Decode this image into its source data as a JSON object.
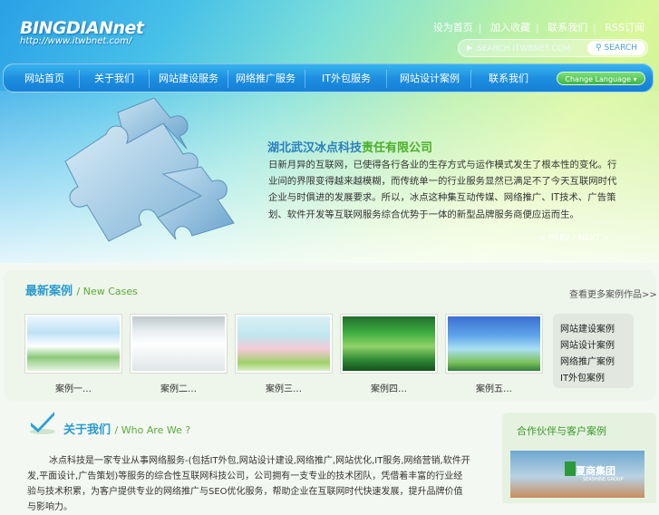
{
  "logo": {
    "brand": "BINGDIANnet",
    "url": "http://www.itwbnet.com/"
  },
  "toplinks": [
    "设为首页",
    "加入收藏",
    "联系我们",
    "RSS订阅"
  ],
  "search": {
    "placeholder": "SEARCH ITWBNET.COM",
    "button": "SEARCH"
  },
  "nav": [
    "网站首页",
    "关于我们",
    "网站建设服务",
    "网络推广服务",
    "IT外包服务",
    "网站设计案例",
    "联系我们"
  ],
  "language": "Change Language",
  "hero": {
    "title_blue": "湖北武汉冰点科技",
    "title_green": "责任有限公司",
    "text": "日新月异的互联网，已使得各行各业的生存方式与运作模式发生了根本性的变化。行业间的界限变得越来越模糊，而传统单一的行业服务显然已满足不了今天互联网时代企业与时俱进的发展要求。所以，冰点这种集互动传媒、网络推广、IT技术、广告策划、软件开发等互联网服务综合优势于一体的新型品牌服务商便应运而生。",
    "prev": "< PREV",
    "next": "NEXT >"
  },
  "cases": {
    "title": "最新案例",
    "title_en": "/ New Cases",
    "more": "查看更多案例作品>>",
    "items": [
      "案例一…",
      "案例二…",
      "案例三…",
      "案例四…",
      "案例五…"
    ],
    "categories": [
      "网站建设案例",
      "网站设计案例",
      "网络推广案例",
      "IT外包案例"
    ]
  },
  "who": {
    "title": "关于我们",
    "title_en": "/ Who Are We ?",
    "text": "冰点科技是一家专业从事网络服务-(包括IT外包,网站设计建设,网络推广,网站优化,IT服务,网络营销,软件开发,平面设计,广告策划)等服务的综合性互联网科技公司，公司拥有一支专业的技术团队，凭借着丰富的行业经验与技术积累，为客户提供专业的网络推广与SEO优化服务，帮助企业在互联网时代快速发展，提升品牌价值与影响力。"
  },
  "side": {
    "title": "合作伙伴与客户案例",
    "pic_brand": "夏商集团",
    "pic_sub": "SEASHINE GROUP"
  }
}
